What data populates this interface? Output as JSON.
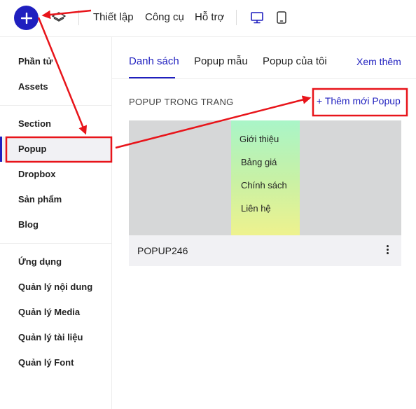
{
  "topbar": {
    "add_icon": "plus-icon",
    "layers_icon": "layers-icon",
    "menu": [
      "Thiết lập",
      "Công cụ",
      "Hỗ trợ"
    ],
    "devices": [
      "desktop-icon",
      "tablet-icon"
    ]
  },
  "sidebar": {
    "items": [
      "Phần tử",
      "Assets",
      "Section",
      "Popup",
      "Dropbox",
      "Sản phẩm",
      "Blog",
      "Ứng dụng",
      "Quản lý nội dung",
      "Quản lý Media",
      "Quản lý tài liệu",
      "Quản lý Font"
    ],
    "active": "Popup"
  },
  "tabs": {
    "items": [
      "Danh sách",
      "Popup mẫu",
      "Popup của tôi"
    ],
    "active": "Danh sách",
    "more": "Xem thêm"
  },
  "section": {
    "title": "POPUP TRONG TRANG",
    "add_button": "+ Thêm mới Popup"
  },
  "popup": {
    "name": "POPUP246",
    "menu_items": [
      "Giới thiệu",
      "Bảng giá",
      "Chính sách",
      "Liên hệ"
    ]
  },
  "colors": {
    "accent": "#1f1fbf",
    "annotation": "#e8141a"
  }
}
